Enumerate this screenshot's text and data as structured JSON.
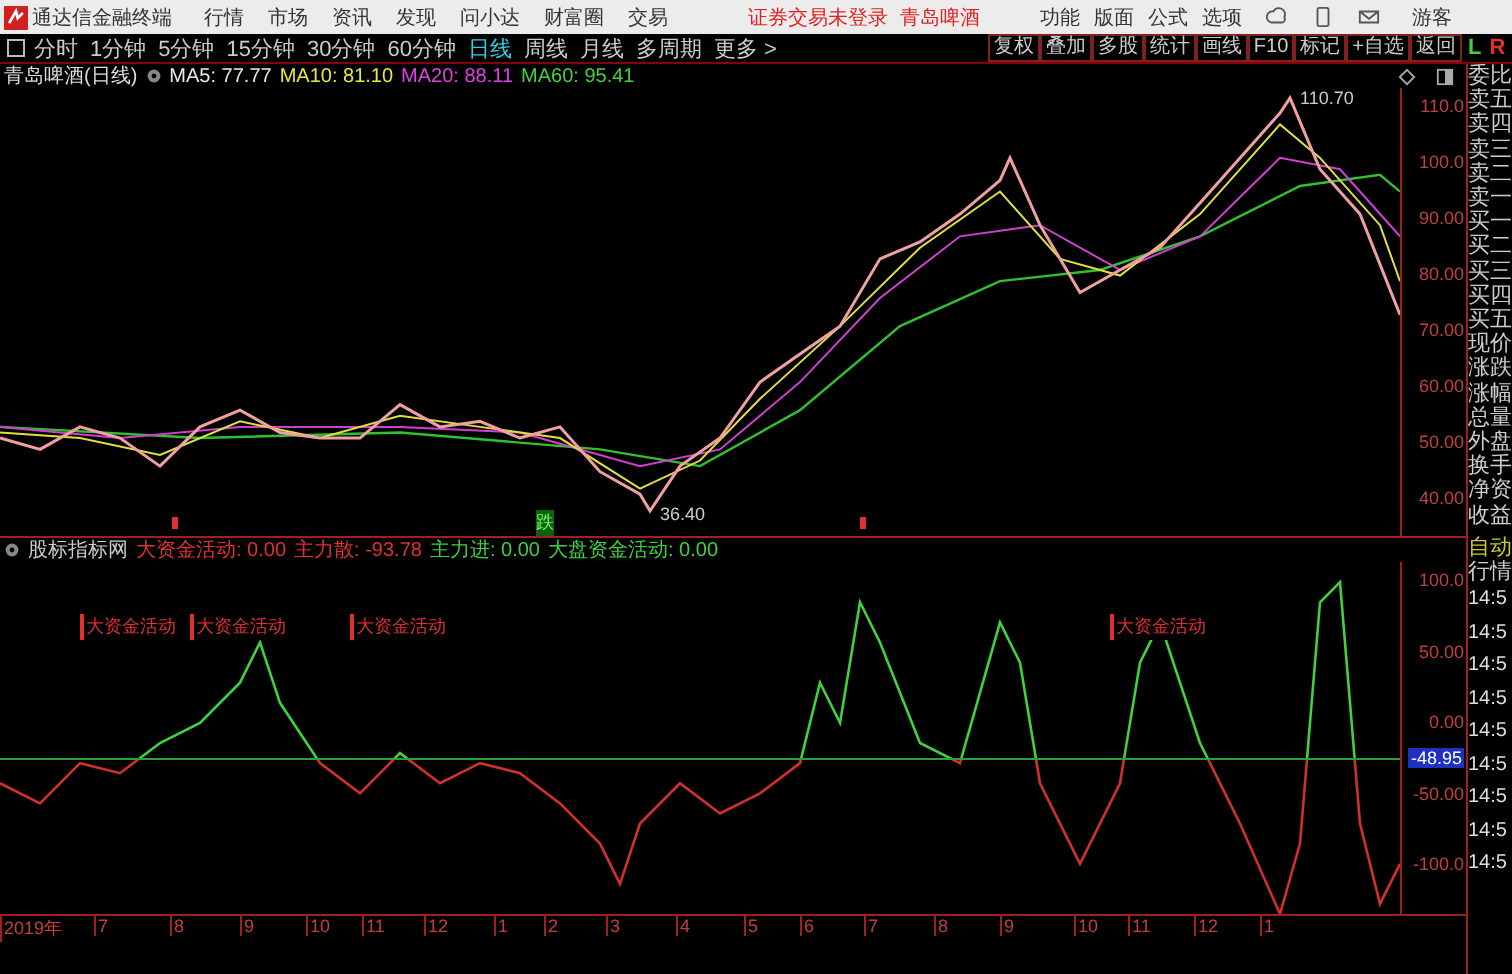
{
  "menu_bar": {
    "app_title": "通达信金融终端",
    "menus": [
      "行情",
      "市场",
      "资讯",
      "发现",
      "问小达",
      "财富圈",
      "交易"
    ],
    "login_status": "证券交易未登录",
    "stock_name": "青岛啤酒",
    "actions": [
      "功能",
      "版面",
      "公式",
      "选项"
    ],
    "user": "游客"
  },
  "period_bar": {
    "periods": [
      {
        "label": "分时",
        "selected": false
      },
      {
        "label": "1分钟",
        "selected": false
      },
      {
        "label": "5分钟",
        "selected": false
      },
      {
        "label": "15分钟",
        "selected": false
      },
      {
        "label": "30分钟",
        "selected": false
      },
      {
        "label": "60分钟",
        "selected": false
      },
      {
        "label": "日线",
        "selected": true
      },
      {
        "label": "周线",
        "selected": false
      },
      {
        "label": "月线",
        "selected": false
      },
      {
        "label": "多周期",
        "selected": false
      }
    ],
    "more": "更多 >",
    "tools": [
      "复权",
      "叠加",
      "多股",
      "统计",
      "画线",
      "F10",
      "标记",
      "+自选",
      "返回"
    ]
  },
  "price_chart": {
    "title": "青岛啤酒(日线)",
    "ma": [
      {
        "label": "MA5: 77.77",
        "color": "#e8e8e8"
      },
      {
        "label": "MA10: 81.10",
        "color": "#e8e838"
      },
      {
        "label": "MA20: 88.11",
        "color": "#e040e0"
      },
      {
        "label": "MA60: 95.41",
        "color": "#40d040"
      }
    ],
    "axis": [
      "110.0",
      "100.0",
      "90.00",
      "80.00",
      "70.00",
      "60.00",
      "50.00",
      "40.00"
    ],
    "high_label": "110.70",
    "low_label": "36.40",
    "signal": "跌"
  },
  "indicator": {
    "title": "股标指标网",
    "values": [
      {
        "label": "大资金活动: 0.00",
        "color": "#e03030"
      },
      {
        "label": "主力散: -93.78",
        "color": "#e03030"
      },
      {
        "label": "主力进: 0.00",
        "color": "#40d040"
      },
      {
        "label": "大盘资金活动: 0.00",
        "color": "#40d040"
      }
    ],
    "signals": [
      "大资金活动",
      "大资金活动",
      "大资金活动",
      "大资金活动"
    ],
    "axis": [
      "100.0",
      "50.00",
      "0.00",
      "-50.00",
      "-100.0"
    ],
    "cursor_value": "-48.95"
  },
  "date_axis": [
    "2019年",
    "7",
    "8",
    "9",
    "10",
    "11",
    "12",
    "1",
    "2",
    "3",
    "4",
    "5",
    "6",
    "7",
    "8",
    "9",
    "10",
    "11",
    "12",
    "1"
  ],
  "quote_panel": {
    "corner": [
      {
        "label": "L",
        "color": "#40d040"
      },
      {
        "label": "R",
        "color": "#e03030"
      }
    ],
    "fields": [
      "委比",
      "卖五",
      "卖四",
      "卖三",
      "卖二",
      "卖一",
      "买一",
      "买二",
      "买三",
      "买四",
      "买五",
      "现价",
      "涨跌",
      "涨幅",
      "总量",
      "外盘",
      "换手",
      "净资",
      "收益"
    ],
    "modes": [
      "自动",
      "行情"
    ],
    "times": [
      "14:5",
      "14:5",
      "14:5",
      "14:5",
      "14:5",
      "14:5",
      "14:5",
      "14:5",
      "14:5"
    ]
  }
}
